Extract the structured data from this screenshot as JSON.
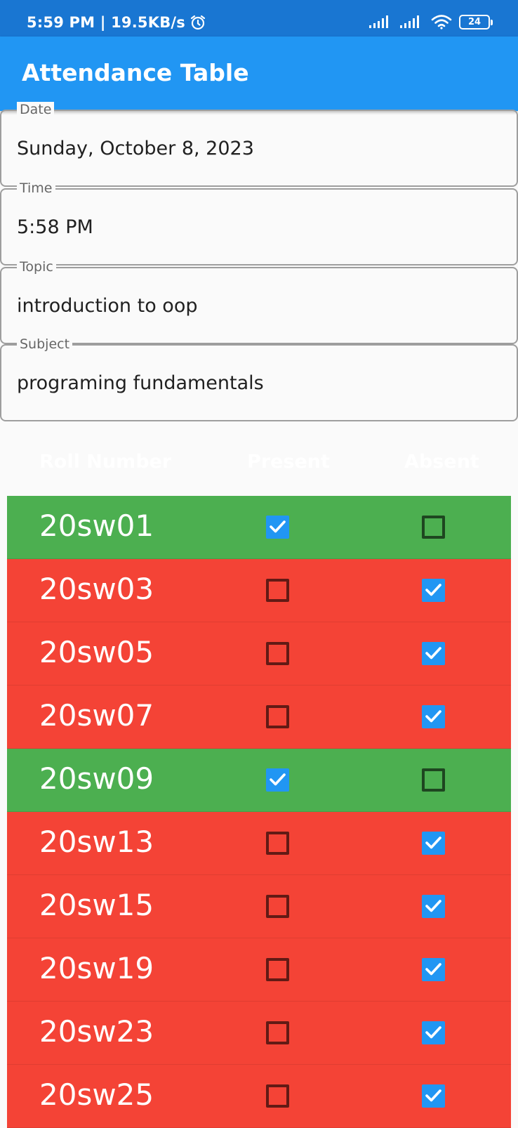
{
  "status_bar": {
    "time_speed": "5:59 PM | 19.5KB/s",
    "battery": "24"
  },
  "app_bar": {
    "title": "Attendance Table"
  },
  "fields": [
    {
      "label": "Date",
      "value": "Sunday, October 8, 2023"
    },
    {
      "label": "Time",
      "value": "5:58 PM"
    },
    {
      "label": "Topic",
      "value": "introduction to oop"
    },
    {
      "label": "Subject",
      "value": "programing fundamentals"
    }
  ],
  "table": {
    "headers": [
      "Roll Number",
      "Present",
      "Absent"
    ],
    "rows": [
      {
        "roll": "20sw01",
        "present": true
      },
      {
        "roll": "20sw03",
        "present": false
      },
      {
        "roll": "20sw05",
        "present": false
      },
      {
        "roll": "20sw07",
        "present": false
      },
      {
        "roll": "20sw09",
        "present": true
      },
      {
        "roll": "20sw13",
        "present": false
      },
      {
        "roll": "20sw15",
        "present": false
      },
      {
        "roll": "20sw19",
        "present": false
      },
      {
        "roll": "20sw23",
        "present": false
      },
      {
        "roll": "20sw25",
        "present": false
      }
    ]
  },
  "colors": {
    "app_bar": "#2196f3",
    "status_bar": "#1976d2",
    "present_row": "#4caf50",
    "absent_row": "#f44336",
    "checkbox_checked": "#2196f3"
  }
}
